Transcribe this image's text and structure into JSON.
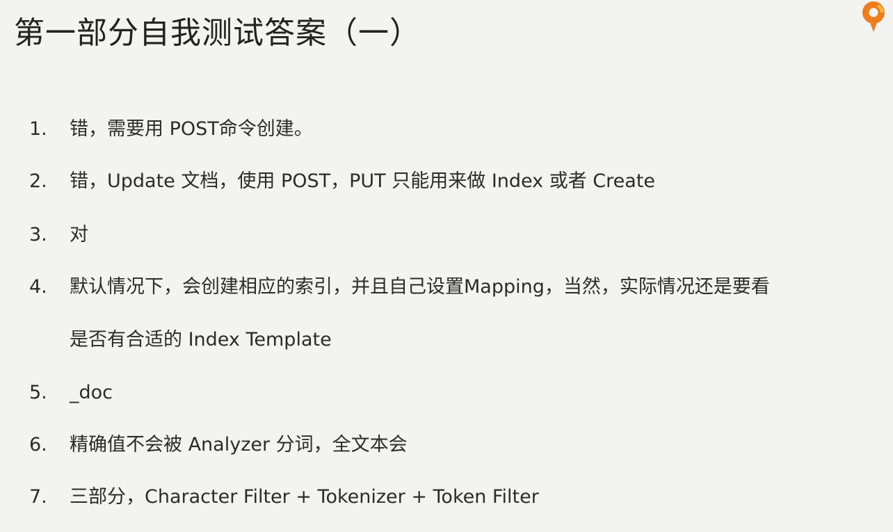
{
  "slide": {
    "title": "第一部分自我测试答案（一）",
    "answers": [
      {
        "number": "1.",
        "text": "错，需要用 POST命令创建。"
      },
      {
        "number": "2.",
        "text": "错，Update 文档，使用 POST，PUT 只能用来做 Index 或者 Create"
      },
      {
        "number": "3.",
        "text": "对"
      },
      {
        "number": "4.",
        "text": "默认情况下，会创建相应的索引，并且自己设置Mapping，当然，实际情况还是要看",
        "continuation": "是否有合适的 Index Template"
      },
      {
        "number": "5.",
        "text": "_doc"
      },
      {
        "number": "6.",
        "text": "精确值不会被 Analyzer 分词，全文本会"
      },
      {
        "number": "7.",
        "text": "三部分，Character Filter + Tokenizer + Token Filter"
      }
    ]
  },
  "logo": {
    "icon": "brand-logo-icon",
    "colors": {
      "primary": "#f07c1c",
      "accent": "#f5b24a"
    }
  }
}
